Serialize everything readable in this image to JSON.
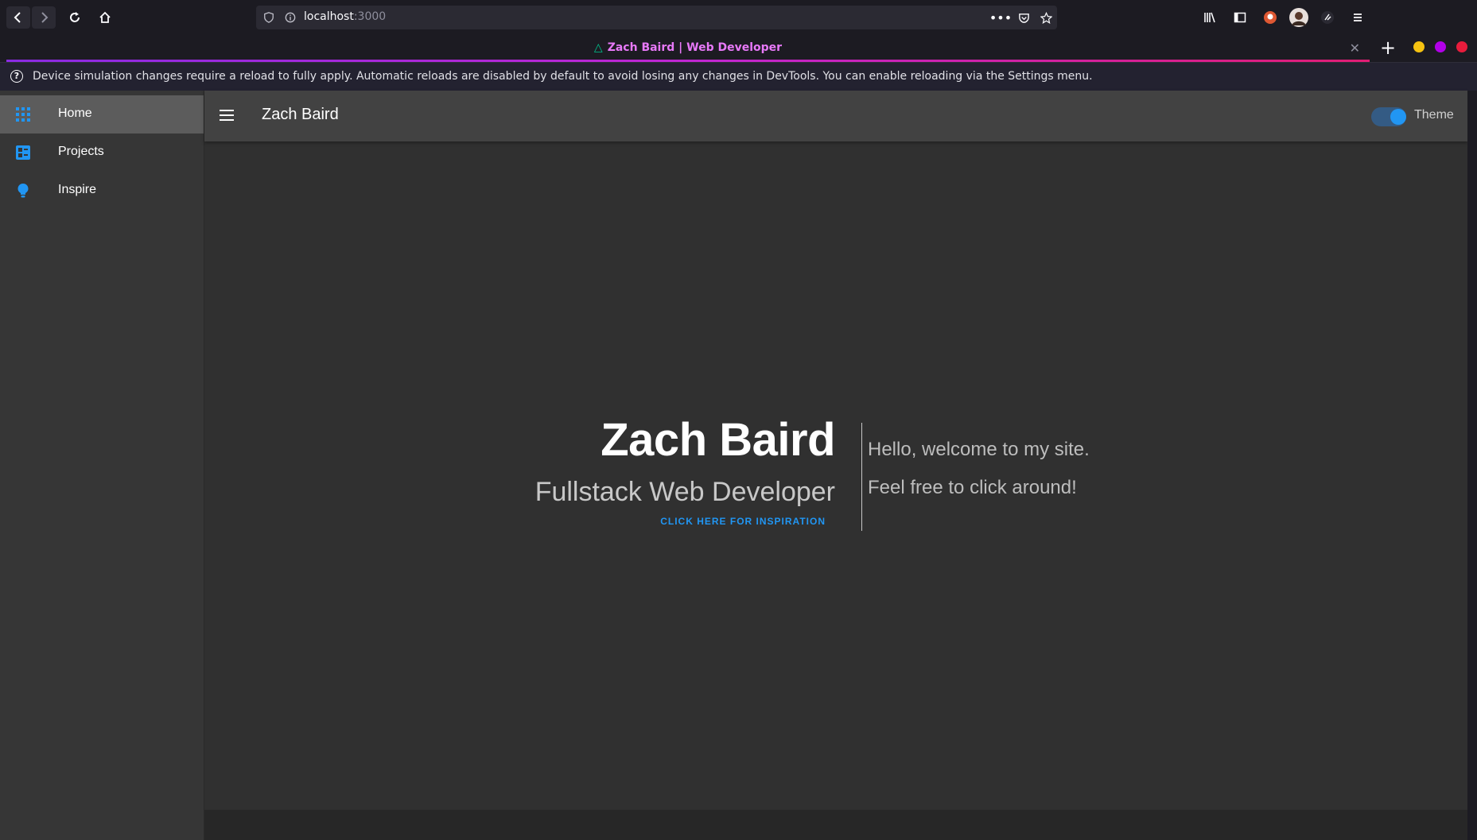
{
  "browser": {
    "url_host": "localhost",
    "url_port": ":3000",
    "tab_title": "Zach Baird | Web Developer",
    "tab_icon": "nuxt-triangle-icon",
    "dot_colors": [
      "#f5c211",
      "#b100e8",
      "#e81c3c"
    ]
  },
  "infobar": {
    "message": "Device simulation changes require a reload to fully apply. Automatic reloads are disabled by default to avoid losing any changes in DevTools. You can enable reloading via the Settings menu."
  },
  "sidebar": {
    "items": [
      {
        "label": "Home",
        "icon": "apps-grid-icon",
        "active": true
      },
      {
        "label": "Projects",
        "icon": "view-dashboard-icon",
        "active": false
      },
      {
        "label": "Inspire",
        "icon": "lightbulb-icon",
        "active": false
      }
    ]
  },
  "appbar": {
    "title": "Zach Baird",
    "theme_label": "Theme",
    "theme_on": true
  },
  "hero": {
    "name": "Zach Baird",
    "subtitle": "Fullstack Web Developer",
    "link": "CLICK HERE FOR INSPIRATION",
    "messages": [
      "Hello, welcome to my site.",
      "Feel free to click around!"
    ]
  },
  "colors": {
    "accent": "#2196f3",
    "background": "#303030",
    "appbar": "#424242",
    "sidebar": "#363636"
  }
}
